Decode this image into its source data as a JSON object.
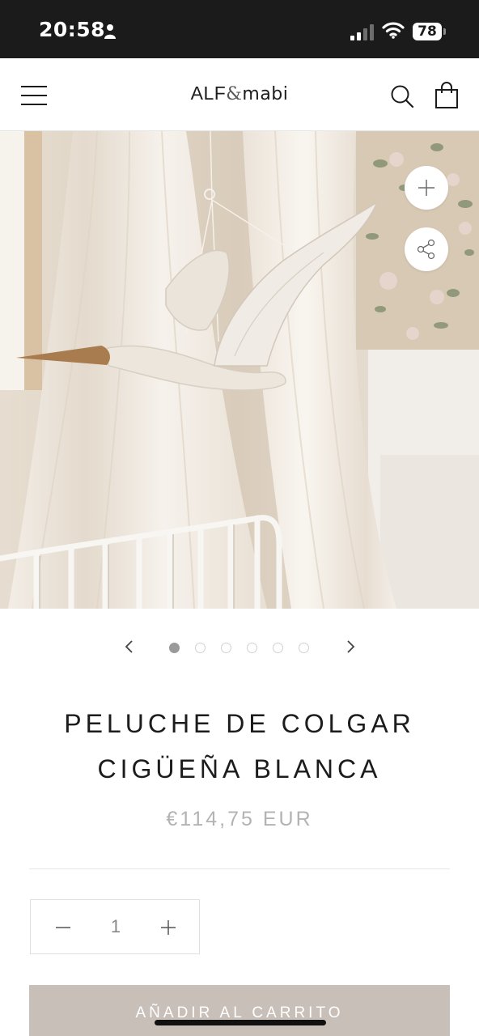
{
  "status_bar": {
    "time": "20:58",
    "battery": "78",
    "icons": [
      "person-icon",
      "cellular-signal-icon",
      "wifi-icon",
      "battery-icon"
    ]
  },
  "header": {
    "logo_alf": "ALF",
    "logo_amp": "&",
    "logo_mabi": "mabi",
    "icons": [
      "menu-icon",
      "search-icon",
      "shopping-bag-icon"
    ]
  },
  "gallery": {
    "image_count": 6,
    "active_index": 0,
    "icons": [
      "plus-icon",
      "share-icon",
      "chevron-left-icon",
      "chevron-right-icon"
    ]
  },
  "product": {
    "title_line1": "PELUCHE DE COLGAR",
    "title_line2": "CIGÜEÑA BLANCA",
    "price": "€114,75 EUR",
    "quantity": "1",
    "add_to_cart_label": "AÑADIR AL CARRITO"
  },
  "colors": {
    "status_bar_bg": "#1b1b1b",
    "price_text": "#b3b3b3",
    "add_to_cart_bg": "#c7bfb8",
    "active_dot": "#9a9a9a"
  }
}
